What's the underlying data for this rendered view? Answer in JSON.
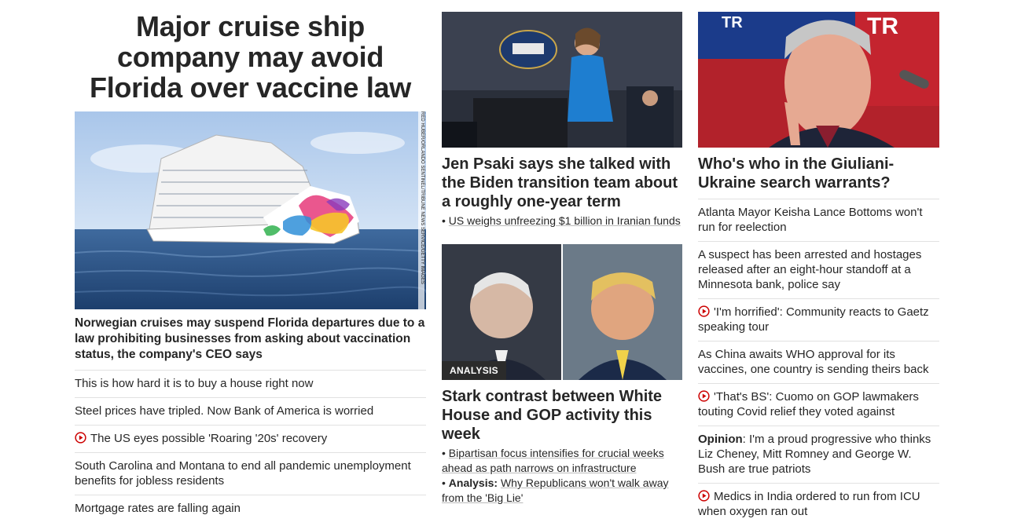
{
  "col1": {
    "headline": "Major cruise ship company may avoid Florida over vaccine law",
    "image_credit": "RED HUBER/ORLANDO SENTINEL/TRIBUNE NEWS SERVICE/GETTY IMAGES",
    "lead": "Norwegian cruises may suspend Florida departures due to a law prohibiting businesses from asking about vaccination status, the company's CEO says",
    "stories": [
      {
        "text": "This is how hard it is to buy a house right now",
        "video": false
      },
      {
        "text": "Steel prices have tripled. Now Bank of America is worried",
        "video": false
      },
      {
        "text": "The US eyes possible 'Roaring '20s' recovery",
        "video": true
      },
      {
        "text": "South Carolina and Montana to end all pandemic unemployment benefits for jobless residents",
        "video": false
      },
      {
        "text": "Mortgage rates are falling again",
        "video": false
      }
    ]
  },
  "col2": {
    "story1": {
      "headline": "Jen Psaki says she talked with the Biden transition team about a roughly one-year term",
      "bullet": "US weighs unfreezing $1 billion in Iranian funds"
    },
    "story2": {
      "badge": "ANALYSIS",
      "headline": "Stark contrast between White House and GOP activity this week",
      "bullet1": "Bipartisan focus intensifies for crucial weeks ahead as path narrows on infrastructure",
      "bullet2_prefix": "Analysis:",
      "bullet2": "Why Republicans won't walk away from the 'Big Lie'"
    }
  },
  "col3": {
    "headline": "Who's who in the Giuliani-Ukraine search warrants?",
    "stories": [
      {
        "text": "Atlanta Mayor Keisha Lance Bottoms won't run for reelection",
        "video": false,
        "prefix": ""
      },
      {
        "text": "A suspect has been arrested and hostages released after an eight-hour standoff at a Minnesota bank, police say",
        "video": false,
        "prefix": ""
      },
      {
        "text": "'I'm horrified': Community reacts to Gaetz speaking tour",
        "video": true,
        "prefix": ""
      },
      {
        "text": "As China awaits WHO approval for its vaccines, one country is sending theirs back",
        "video": false,
        "prefix": ""
      },
      {
        "text": "'That's BS': Cuomo on GOP lawmakers touting Covid relief they voted against",
        "video": true,
        "prefix": ""
      },
      {
        "text": ": I'm a proud progressive who thinks Liz Cheney, Mitt Romney and George W. Bush are true patriots",
        "video": false,
        "prefix": "Opinion"
      },
      {
        "text": "Medics in India ordered to run from ICU when oxygen ran out",
        "video": true,
        "prefix": ""
      }
    ]
  },
  "colors": {
    "video_icon": "#cc0000",
    "divider": "#e1e1e1",
    "badge_bg": "#2b2b2b"
  }
}
